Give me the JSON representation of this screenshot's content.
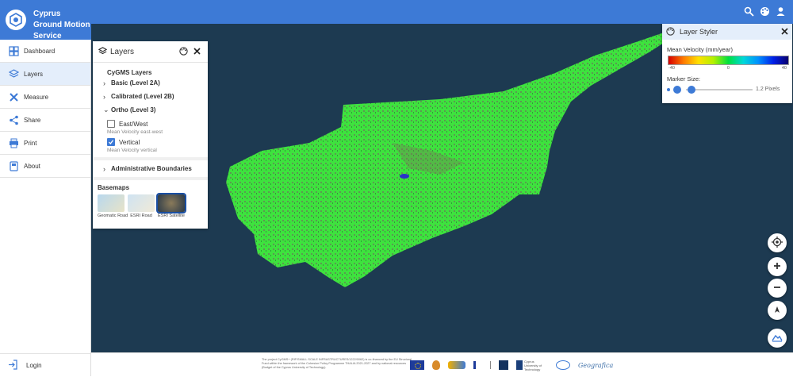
{
  "app": {
    "title": "Cyprus Ground Motion Service"
  },
  "sidebar": {
    "items": [
      {
        "label": "Dashboard",
        "icon": "dashboard-icon"
      },
      {
        "label": "Layers",
        "icon": "layers-icon",
        "active": true
      },
      {
        "label": "Measure",
        "icon": "measure-icon"
      },
      {
        "label": "Share",
        "icon": "share-icon"
      },
      {
        "label": "Print",
        "icon": "print-icon"
      },
      {
        "label": "About",
        "icon": "about-icon"
      }
    ],
    "login": "Login"
  },
  "topbar": {
    "icons": [
      "search-icon",
      "palette-icon",
      "user-icon"
    ]
  },
  "layers_panel": {
    "title": "Layers",
    "section": "CyGMS Layers",
    "groups": {
      "basic": "Basic (Level 2A)",
      "calibrated": "Calibrated (Level 2B)",
      "ortho": "Ortho (Level 3)"
    },
    "ortho_layers": [
      {
        "label": "East/West",
        "desc": "Mean Velocity east-west",
        "checked": false
      },
      {
        "label": "Vertical",
        "desc": "Mean Velocity vertical",
        "checked": true
      }
    ],
    "admin": "Administrative Boundaries",
    "basemaps_title": "Basemaps",
    "basemaps": [
      {
        "label": "Geomatic Road",
        "selected": false
      },
      {
        "label": "ESRI Road",
        "selected": false
      },
      {
        "label": "ESRI Satellite",
        "selected": true
      }
    ]
  },
  "styler": {
    "title": "Layer Styler",
    "velocity_label": "Mean Velocity (mm/year)",
    "ramp_min": "-40",
    "ramp_zero": "0",
    "ramp_max": "40",
    "marker_label": "Marker Size:",
    "marker_value": "1.2 Pixels",
    "marker_fraction": 0.05
  },
  "footer": {
    "note": "The project CyGMS+ (RIF/SMALL SCALE INFRASTRUCTURES/1222/0062) is co-financed by the EU Structural Fund within the framework of the Cohesion Policy Programme THALIA 2021-2027 and by national resources (Budget of the Cyprus University of Technology).",
    "logos": [
      "eu-flag-logo",
      "cyprus-emblem-logo",
      "thalia-logo",
      "research-foundation-logo",
      "eratosthenes-logo",
      "cut-logo",
      "geonet-logo",
      "geografica-logo"
    ],
    "cut_text": "Cyprus University of Technology",
    "geografica_text": "Geografica"
  },
  "colors": {
    "primary": "#3d7ad6",
    "active_bg": "#e4eefb",
    "sea": "#1d3a51",
    "land_points": "#3ee23e"
  }
}
